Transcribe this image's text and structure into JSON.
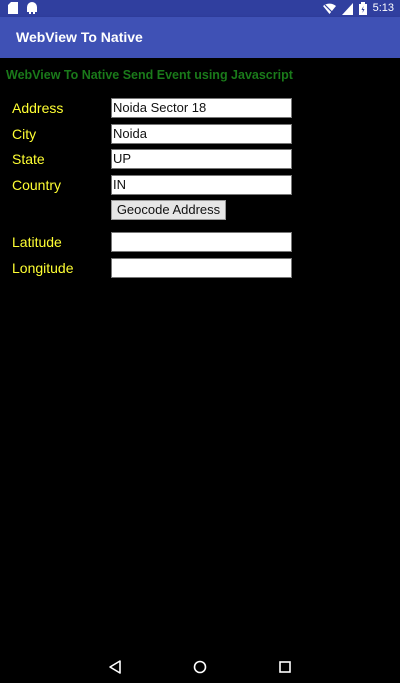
{
  "status_bar": {
    "time": "5:13",
    "icons": [
      "sd-card-icon",
      "android-icon",
      "wifi-icon",
      "signal-icon",
      "battery-icon"
    ],
    "background": "#303F9F"
  },
  "app_bar": {
    "title": "WebView To Native",
    "background": "#3F51B5"
  },
  "page": {
    "heading": "WebView To Native Send Event using Javascript",
    "heading_color": "#1a7a1a",
    "label_color": "#ffff33",
    "fields": {
      "address": {
        "label": "Address",
        "value": "Noida Sector 18"
      },
      "city": {
        "label": "City",
        "value": "Noida"
      },
      "state": {
        "label": "State",
        "value": "UP"
      },
      "country": {
        "label": "Country",
        "value": "IN"
      },
      "latitude": {
        "label": "Latitude",
        "value": ""
      },
      "longitude": {
        "label": "Longitude",
        "value": ""
      }
    },
    "geocode_button_label": "Geocode Address"
  },
  "nav_bar": {
    "icons": [
      "back-icon",
      "home-icon",
      "recents-icon"
    ]
  }
}
